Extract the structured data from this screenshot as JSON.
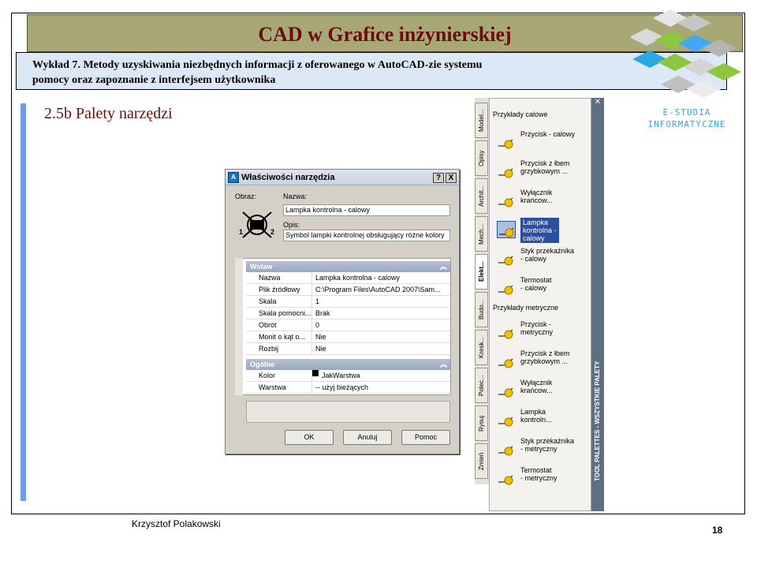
{
  "slide": {
    "title": "CAD w Grafice inżynierskiej",
    "subtitle_line1": "Wykład 7.  Metody uzyskiwania niezbędnych informacji z oferowanego w AutoCAD-zie systemu",
    "subtitle_line2": "pomocy oraz zapoznanie z interfejsem użytkownika",
    "section": "2.5b Palety narzędzi",
    "author": "Krzysztof Polakowski",
    "page": "18"
  },
  "logo": {
    "line1": "E-STUDIA",
    "line2": "INFORMATYCZNE"
  },
  "dialog": {
    "title": "Właściwości narzędzia",
    "help_btn": "?",
    "close_btn": "X",
    "image_label": "Obraz:",
    "name_label": "Nazwa:",
    "name_value": "Lampka kontrolna - calowy",
    "desc_label": "Opis:",
    "desc_value": "Symbol lampki kontrolnej obsługujący różne kolory",
    "num1": "1",
    "num2": "2",
    "group1": "Wstaw",
    "group2": "Ogólne",
    "rows1": [
      [
        "Nazwa",
        "Lampka kontrolna - calowy"
      ],
      [
        "Plik źródłowy",
        "C:\\Program Files\\AutoCAD 2007\\Sam..."
      ],
      [
        "Skala",
        "1"
      ],
      [
        "Skala pomocni...",
        "Brak"
      ],
      [
        "Obrót",
        "0"
      ],
      [
        "Monit o kąt o...",
        "Nie"
      ],
      [
        "Rozbij",
        "Nie"
      ]
    ],
    "rows2": [
      [
        "Kolor",
        "JakWarstwa"
      ],
      [
        "Warstwa",
        "-- użyj bieżących"
      ]
    ],
    "ok": "OK",
    "cancel": "Anuluj",
    "help": "Pomoc"
  },
  "palette": {
    "tabs": [
      "Model...",
      "Opisy",
      "Archit...",
      "Mech...",
      "Elekt...",
      "Budo...",
      "Kresk...",
      "Polec...",
      "Rysuj",
      "Zmień"
    ],
    "header1": "Przykłady calowe",
    "header2": "Przykłady metryczne",
    "strip_title": "TOOL PALETTES - WSZYSTKIE PALETY",
    "items1": [
      [
        "Przycisk - calowy",
        ""
      ],
      [
        "Przycisk z łbem",
        "grzybkowym ..."
      ],
      [
        "Wyłącznik",
        "krańcow..."
      ],
      [
        "Lampka",
        "kontrolna -",
        "calowy"
      ],
      [
        "Styk przekaźnika",
        "- calowy"
      ],
      [
        "Termostat",
        "- calowy"
      ]
    ],
    "items2": [
      [
        "Przycisk -",
        "metryczny"
      ],
      [
        "Przycisk z łbem",
        "grzybkowym ..."
      ],
      [
        "Wyłącznik",
        "krańcow..."
      ],
      [
        "Lampka",
        "kontroln..."
      ],
      [
        "Styk przekaźnika",
        "- metryczny"
      ],
      [
        "Termostat",
        "- metryczny"
      ]
    ]
  }
}
